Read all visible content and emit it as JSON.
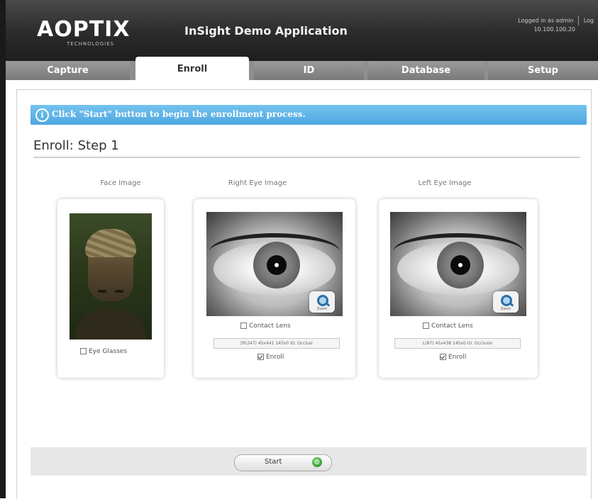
{
  "header": {
    "logo_text": "AOPTIX",
    "logo_subtext": "TECHNOLOGIES",
    "app_title": "InSight Demo Application",
    "login_line1": "Logged in as admin",
    "login_line2": "10.100.100.20",
    "logout_label": "Log"
  },
  "tabs": [
    {
      "label": "Capture",
      "active": false
    },
    {
      "label": "Enroll",
      "active": true
    },
    {
      "label": "ID",
      "active": false
    },
    {
      "label": "Database",
      "active": false
    },
    {
      "label": "Setup",
      "active": false
    }
  ],
  "banner": {
    "icon": "info-icon",
    "message": "Click \"Start\" button to begin the enrollment process."
  },
  "step_title": "Enroll: Step 1",
  "face": {
    "label": "Face Image",
    "eye_glasses_label": "Eye Glasses",
    "eye_glasses_checked": false
  },
  "right_eye": {
    "label": "Right Eye Image",
    "contact_lens_label": "Contact Lens",
    "contact_lens_checked": false,
    "quality_text": "[R(247) 45x441 145x0 IO. Occlusi",
    "enroll_label": "Enroll",
    "enroll_checked": true,
    "zoom_label": "Zoom"
  },
  "left_eye": {
    "label": "Left Eye Image",
    "contact_lens_label": "Contact Lens",
    "contact_lens_checked": false,
    "quality_text": "L(87) 45x438 145x0 IO. Occlusio",
    "enroll_label": "Enroll",
    "enroll_checked": true,
    "zoom_label": "Zoom"
  },
  "footer": {
    "start_label": "Start",
    "start_icon": "go-icon",
    "start_icon_color": "#2f9a2b"
  },
  "colors": {
    "banner": "#5cb3e6",
    "header": "#2b2b2b",
    "tab_inactive": "#8f8f8f"
  }
}
